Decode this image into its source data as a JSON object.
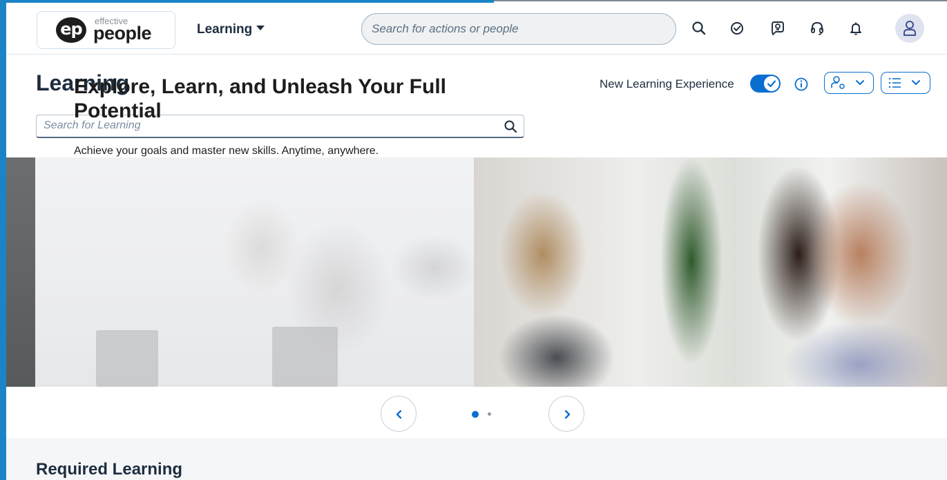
{
  "shell": {
    "logo": {
      "monogram": "ep",
      "small_text": "effective",
      "big_text": "people"
    },
    "nav_menu_label": "Learning",
    "search_placeholder": "Search for actions or people",
    "icons": [
      "search-icon",
      "check-circle-icon",
      "chat-lightbulb-icon",
      "headset-icon",
      "bell-icon",
      "user-avatar-icon"
    ]
  },
  "page": {
    "title": "Learning",
    "new_experience_label": "New Learning Experience",
    "new_experience_enabled": true
  },
  "learning_search": {
    "placeholder": "Search for Learning"
  },
  "hero": {
    "title": "Explore, Learn, and Unleash Your Full Potential",
    "subtitle": "Achieve your goals and master new skills. Anytime, anywhere.",
    "active_slide": 1,
    "slide_count": 2
  },
  "sections": {
    "required_learning_title": "Required Learning"
  },
  "colors": {
    "accent": "#0a6ed1",
    "frame": "#1b84c6",
    "text": "#1d2d3e",
    "band": "#f5f6f7"
  }
}
